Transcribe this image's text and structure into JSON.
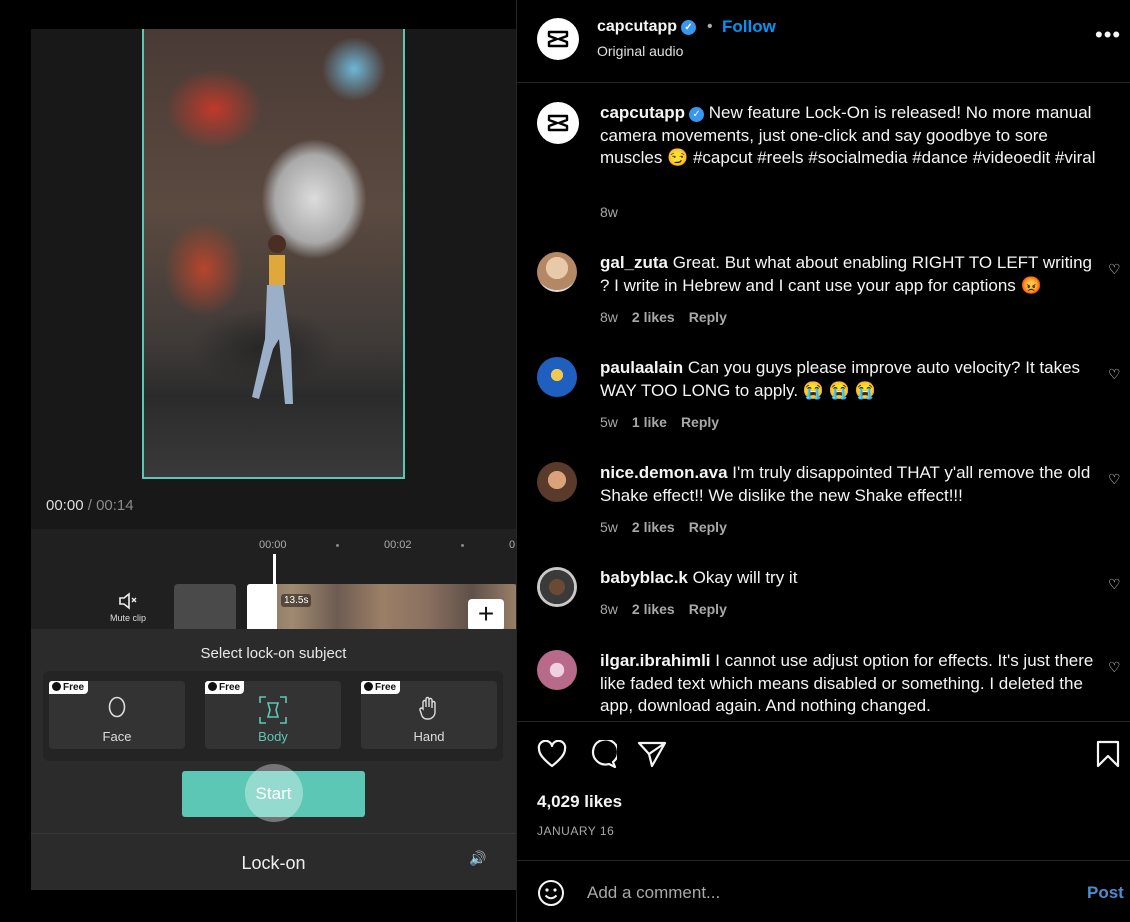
{
  "video": {
    "current_time": "00:00",
    "separator": "/",
    "total_time": "00:14",
    "ruler": [
      "00:00",
      "00:02",
      "0"
    ],
    "mute_label": "Mute clip",
    "clip_duration": "13.5s",
    "sheet_title": "Select lock-on subject",
    "subjects": [
      {
        "label": "Face",
        "badge": "Free",
        "icon": "face-icon"
      },
      {
        "label": "Body",
        "badge": "Free",
        "icon": "body-frame-icon",
        "selected": true
      },
      {
        "label": "Hand",
        "badge": "Free",
        "icon": "hand-icon"
      }
    ],
    "start_label": "Start",
    "bottom_label": "Lock-on",
    "accent": "#5dc7b5"
  },
  "post": {
    "username": "capcutapp",
    "follow_label": "Follow",
    "audio": "Original audio",
    "likes": "4,029 likes",
    "date": "JANUARY 16",
    "comment_placeholder": "Add a comment...",
    "post_label": "Post",
    "caption": {
      "username": "capcutapp",
      "text": " New feature Lock-On is released! No more manual camera movements, just one-click and say goodbye to sore muscles 😏 #capcut #reels #socialmedia #dance #videoedit #viral",
      "age": "8w"
    },
    "comments": [
      {
        "username": "gal_zuta",
        "text": " Great. But what about enabling RIGHT TO LEFT writing ? I write in Hebrew and I cant use your app for captions 😡",
        "age": "8w",
        "likes": "2 likes",
        "reply": "Reply",
        "avatar_color": "#c9a98a"
      },
      {
        "username": "paulaalain",
        "text": " Can you guys please improve auto velocity? It takes WAY TOO LONG to apply. 😭 😭 😭",
        "age": "5w",
        "likes": "1 like",
        "reply": "Reply",
        "avatar_color": "#1f5fbf"
      },
      {
        "username": "nice.demon.ava",
        "text": " I'm truly disappointed THAT y'all remove the old Shake effect!! We dislike the new Shake effect!!!",
        "age": "5w",
        "likes": "2 likes",
        "reply": "Reply",
        "avatar_color": "#5a3a2a"
      },
      {
        "username": "babyblac.k",
        "text": " Okay will try it",
        "age": "8w",
        "likes": "2 likes",
        "reply": "Reply",
        "avatar_color": "#3a3a3a"
      },
      {
        "username": "ilgar.ibrahimli",
        "text": " I cannot use adjust option for effects. It's just there like faded text which means disabled or something. I deleted the app, download again. And nothing changed.",
        "age": "",
        "likes": "",
        "reply": "",
        "avatar_color": "#b86a8a"
      }
    ],
    "colors": {
      "link": "#0095f6",
      "verified": "#3897f0",
      "muted": "#a8a8a8"
    }
  }
}
